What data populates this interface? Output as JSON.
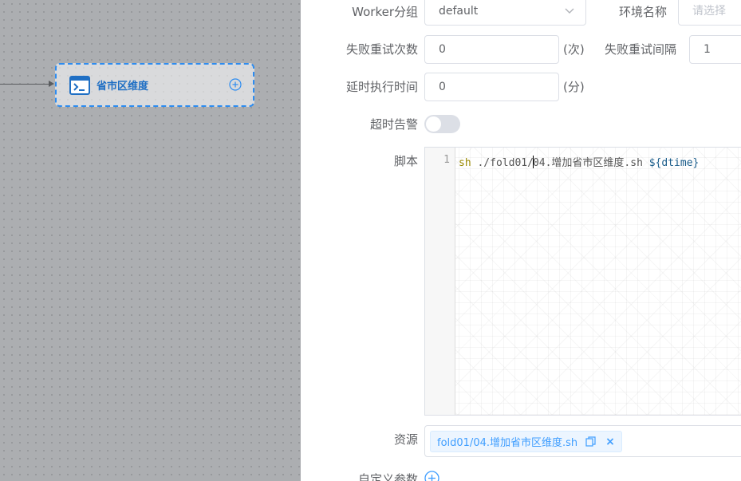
{
  "canvas": {
    "node": {
      "label": "省市区维度",
      "icon": "terminal-icon",
      "add_icon": "plus-circle-icon"
    }
  },
  "form": {
    "worker_group": {
      "label": "Worker分组",
      "value": "default"
    },
    "environment": {
      "label": "环境名称",
      "placeholder": "请选择"
    },
    "retry_times": {
      "label": "失败重试次数",
      "value": "0",
      "unit": "(次)"
    },
    "retry_interval": {
      "label": "失败重试间隔",
      "value": "1"
    },
    "delay_time": {
      "label": "延时执行时间",
      "value": "0",
      "unit": "(分)"
    },
    "timeout_alarm": {
      "label": "超时告警",
      "enabled": false
    },
    "script": {
      "label": "脚本",
      "line_number": "1",
      "code_kw": "sh",
      "code_path_a": " ./fold01/",
      "code_path_b": "04.增加省市区维度.sh ",
      "code_var": "${dtime}"
    },
    "resource": {
      "label": "资源",
      "tag": "fold01/04.增加省市区维度.sh",
      "close": "×"
    },
    "custom_params": {
      "label": "自定义参数"
    }
  },
  "colors": {
    "accent": "#409eff",
    "node_border": "#2d8cf0"
  }
}
